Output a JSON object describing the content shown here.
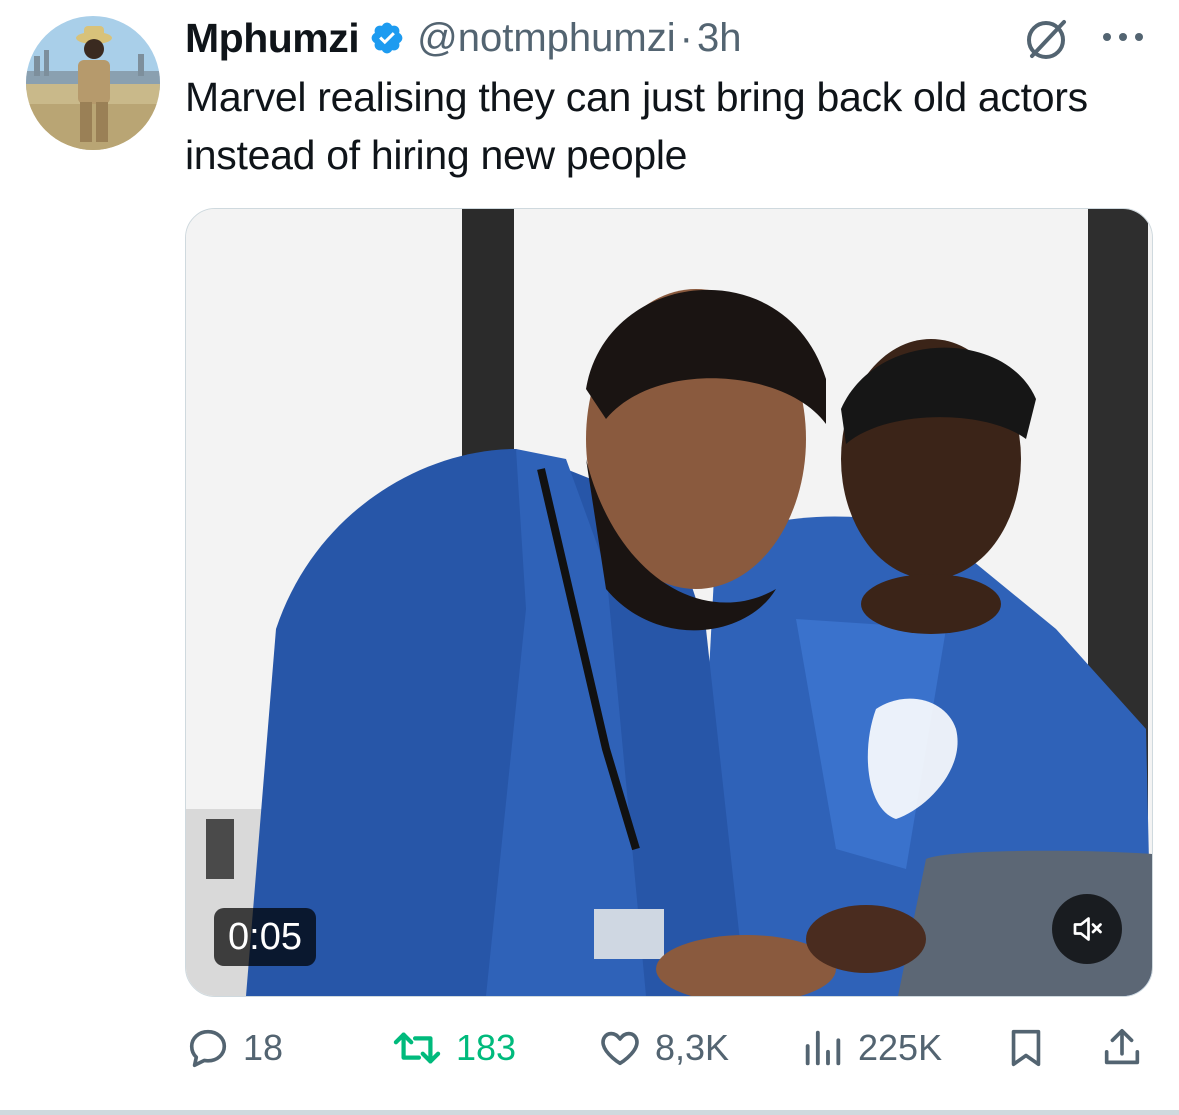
{
  "author": {
    "display_name": "Mphumzi",
    "handle": "@notmphumzi",
    "separator": "·",
    "time": "3h"
  },
  "tweet": {
    "text": "Marvel realising they can just bring back old actors instead of hiring new people"
  },
  "media": {
    "duration": "0:05",
    "muted": true
  },
  "actions": {
    "replies": "18",
    "reposts": "183",
    "likes": "8,3K",
    "views": "225K"
  },
  "colors": {
    "verified": "#1d9bf0",
    "repost": "#00ba7c",
    "secondary_text": "#536471",
    "shirt_blue": "#2f62b8"
  },
  "icons": {
    "verified": "verified-badge-icon",
    "grok": "grok-icon",
    "more": "more-icon",
    "mute": "speaker-muted-icon",
    "reply": "reply-icon",
    "repost": "repost-icon",
    "like": "heart-icon",
    "views": "views-icon",
    "bookmark": "bookmark-icon",
    "share": "share-icon"
  }
}
